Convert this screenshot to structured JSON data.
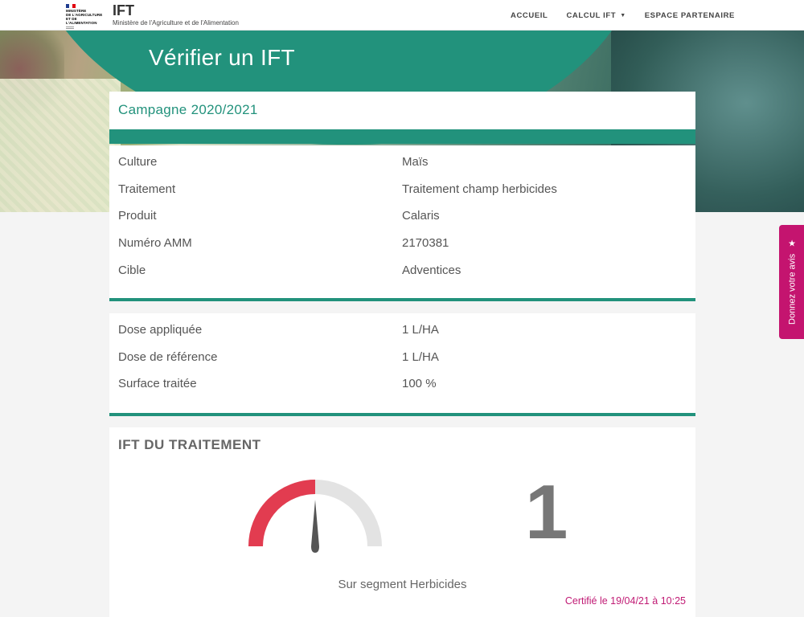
{
  "header": {
    "logo_lines": [
      "MINISTÈRE",
      "DE L'AGRICULTURE",
      "ET DE L'ALIMENTATION"
    ],
    "site_title": "IFT",
    "site_subtitle": "Ministère de l'Agriculture et de l'Alimentation",
    "nav": [
      {
        "label": "ACCUEIL"
      },
      {
        "label": "CALCUL IFT",
        "dropdown": true
      },
      {
        "label": "ESPACE PARTENAIRE"
      }
    ]
  },
  "hero": {
    "title": "Vérifier un IFT"
  },
  "campagne": {
    "label": "Campagne 2020/2021"
  },
  "details": [
    {
      "label": "Culture",
      "value": "Maïs"
    },
    {
      "label": "Traitement",
      "value": "Traitement champ herbicides"
    },
    {
      "label": "Produit",
      "value": "Calaris"
    },
    {
      "label": "Numéro AMM",
      "value": "2170381"
    },
    {
      "label": "Cible",
      "value": "Adventices"
    }
  ],
  "doses": [
    {
      "label": "Dose appliquée",
      "value": "1 L/HA"
    },
    {
      "label": "Dose de référence",
      "value": "1 L/HA"
    },
    {
      "label": "Surface traitée",
      "value": "100 %"
    }
  ],
  "ift": {
    "title": "IFT DU TRAITEMENT",
    "value": "1",
    "gauge_fraction": 0.5,
    "segment_text": "Sur segment Herbicides",
    "certification": "Certifié le 19/04/21 à 10:25"
  },
  "feedback": {
    "label": "Donnez votre avis",
    "icon": "star-icon"
  },
  "colors": {
    "brand_green": "#22927c",
    "gauge_red": "#e23c50",
    "gauge_grey": "#e3e3e3",
    "accent_magenta": "#c4146f"
  }
}
